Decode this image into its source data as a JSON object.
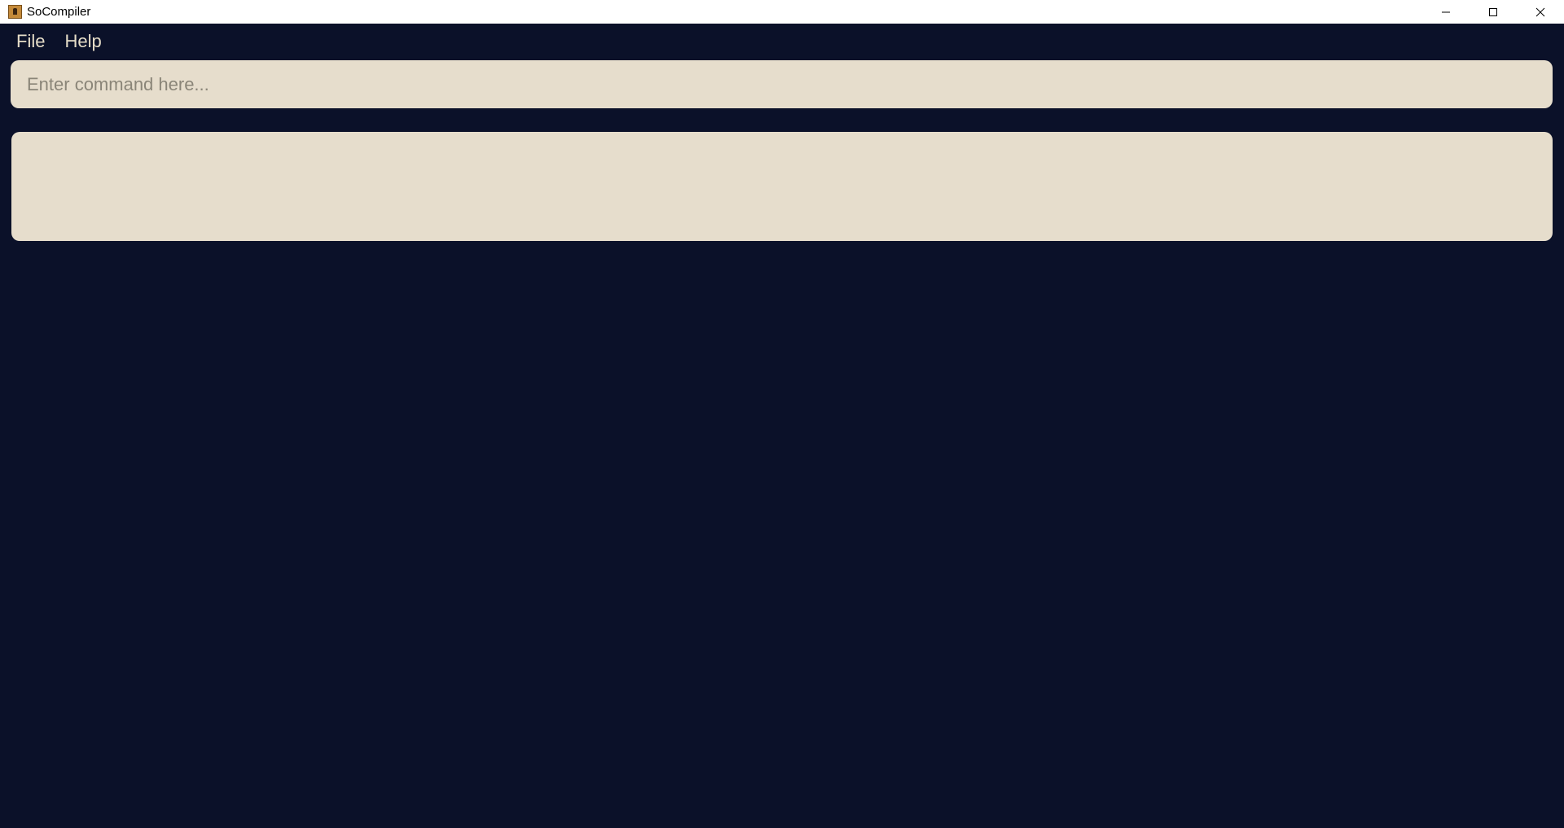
{
  "window": {
    "title": "SoCompiler",
    "controls": [
      "minimize-icon",
      "maximize-icon",
      "close-icon"
    ]
  },
  "menubar": {
    "items": [
      {
        "label": "File"
      },
      {
        "label": "Help"
      }
    ]
  },
  "command": {
    "value": "",
    "placeholder": "Enter command here..."
  },
  "result": {
    "text": ""
  },
  "colors": {
    "background": "#0b1129",
    "panel": "#e6ddcc",
    "menu_text": "#e6ddc8",
    "titlebar": "#ffffff"
  }
}
